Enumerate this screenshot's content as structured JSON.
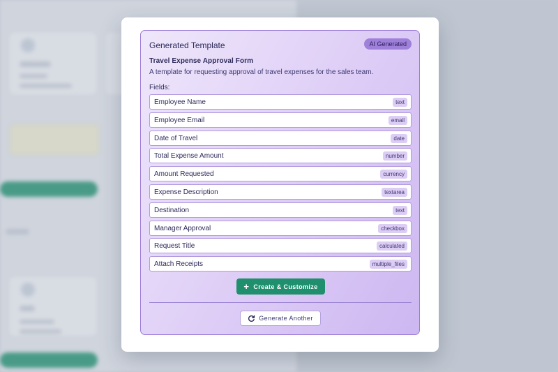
{
  "panel": {
    "title": "Generated Template",
    "badge": "AI Generated"
  },
  "template": {
    "name": "Travel Expense Approval Form",
    "description": "A template for requesting approval of travel expenses for the sales team."
  },
  "fields_label": "Fields:",
  "fields": [
    {
      "name": "Employee Name",
      "type": "text"
    },
    {
      "name": "Employee Email",
      "type": "email"
    },
    {
      "name": "Date of Travel",
      "type": "date"
    },
    {
      "name": "Total Expense Amount",
      "type": "number"
    },
    {
      "name": "Amount Requested",
      "type": "currency"
    },
    {
      "name": "Expense Description",
      "type": "textarea"
    },
    {
      "name": "Destination",
      "type": "text"
    },
    {
      "name": "Manager Approval",
      "type": "checkbox"
    },
    {
      "name": "Request Title",
      "type": "calculated"
    },
    {
      "name": "Attach Receipts",
      "type": "multiple_files"
    }
  ],
  "actions": {
    "create_label": "Create & Customize",
    "generate_label": "Generate Another"
  },
  "icons": {
    "create": "plus-icon",
    "generate": "refresh-icon"
  },
  "colors": {
    "primary_green": "#1f8f6d",
    "panel_border": "#9a7ad8",
    "badge_bg": "#9e7fd9"
  }
}
